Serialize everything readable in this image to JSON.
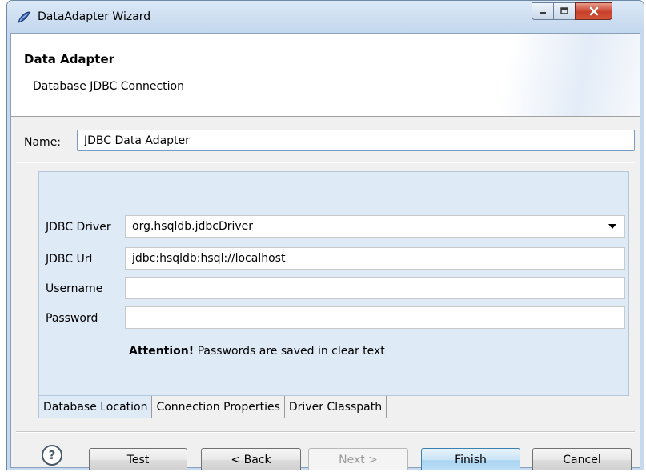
{
  "window": {
    "title": "DataAdapter Wizard"
  },
  "header": {
    "title": "Data Adapter",
    "description": "Database JDBC Connection"
  },
  "name": {
    "label": "Name:",
    "value": "JDBC Data Adapter"
  },
  "fields": {
    "driver": {
      "label": "JDBC Driver",
      "value": "org.hsqldb.jdbcDriver"
    },
    "url": {
      "label": "JDBC Url",
      "value": "jdbc:hsqldb:hsql://localhost"
    },
    "username": {
      "label": "Username",
      "value": ""
    },
    "password": {
      "label": "Password",
      "value": ""
    }
  },
  "attention": {
    "strong": "Attention!",
    "text": "Passwords are saved in clear text"
  },
  "tabs": [
    {
      "label": "Database Location",
      "active": true
    },
    {
      "label": "Connection Properties",
      "active": false
    },
    {
      "label": "Driver Classpath",
      "active": false
    }
  ],
  "buttons": {
    "help": "?",
    "test": "Test",
    "back": "< Back",
    "next": "Next >",
    "finish": "Finish",
    "cancel": "Cancel"
  },
  "colors": {
    "accent": "#3c7fb1",
    "panel": "#deeaf6",
    "close_button": "#c7402a"
  }
}
